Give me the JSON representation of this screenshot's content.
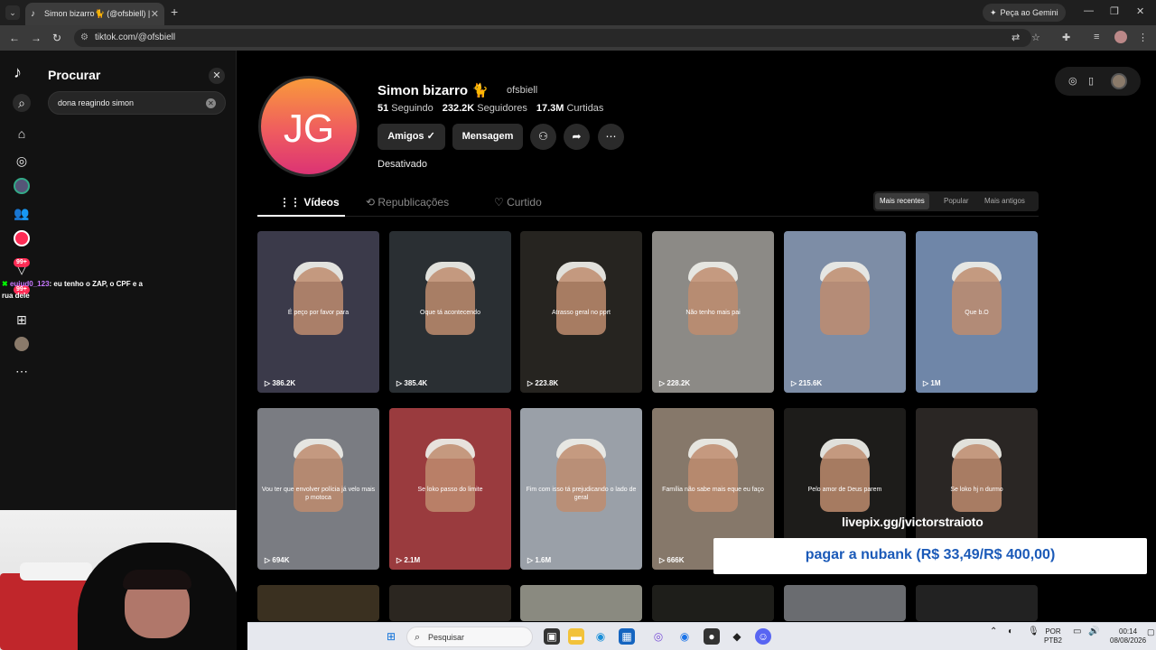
{
  "browser": {
    "tab_title": "Simon bizarro🐈 (@ofsbiell) | T",
    "gemini_label": "Peça ao Gemini",
    "url": "tiktok.com/@ofsbiell"
  },
  "sidebar": {
    "search_title": "Procurar",
    "search_value": "dona reagindo simon",
    "badge_1": "99+",
    "badge_2": "99+",
    "chat_user": "euiud0_123",
    "chat_text": ": eu tenho o ZAP, o CPF e a rua dele"
  },
  "profile": {
    "avatar_initials": "JG",
    "name": "Simon bizarro 🐈",
    "handle": "ofsbiell",
    "following_count": "51",
    "following_label": "Seguindo",
    "followers_count": "232.2K",
    "followers_label": "Seguidores",
    "likes_count": "17.3M",
    "likes_label": "Curtidas",
    "friends_button": "Amigos ✓",
    "message_button": "Mensagem",
    "bio": "Desativado"
  },
  "tabs": {
    "videos": "Vídeos",
    "reposts": "Republicações",
    "liked": "Curtido",
    "sort_recent": "Mais recentes",
    "sort_popular": "Popular",
    "sort_oldest": "Mais antigos"
  },
  "videos": [
    {
      "caption": "É peço por favor para",
      "views": "386.2K",
      "color": "#3b3a4a"
    },
    {
      "caption": "Oque tá acontecendo",
      "views": "385.4K",
      "color": "#2a2f33"
    },
    {
      "caption": "Atrasso geral no pprt",
      "views": "223.8K",
      "color": "#262420"
    },
    {
      "caption": "Não tenho mais pai",
      "views": "228.2K",
      "color": "#8c8a86"
    },
    {
      "caption": "",
      "views": "215.6K",
      "color": "#7d8da6"
    },
    {
      "caption": "Que b.O",
      "views": "1M",
      "color": "#6f86a8"
    },
    {
      "caption": "Vou ter que envolver polícia já velo mais p motoca",
      "views": "694K",
      "color": "#7a7c82"
    },
    {
      "caption": "Se loko passo do limite",
      "views": "2.1M",
      "color": "#9a3b3e"
    },
    {
      "caption": "Fim com isso tá prejudicando o lado de geral",
      "views": "1.6M",
      "color": "#9aa0a8"
    },
    {
      "caption": "Família não sabe mais eque eu faço",
      "views": "666K",
      "color": "#86786a"
    },
    {
      "caption": "Pelo amor de Deus parem",
      "views": "",
      "color": "#1d1c1a"
    },
    {
      "caption": "Se loko hj n durmo",
      "views": "",
      "color": "#2a2624"
    }
  ],
  "stream_overlay": {
    "livepix": "livepix.gg/jvictorstraioto",
    "goal": "pagar a nubank (R$ 33,49/R$ 400,00)"
  },
  "taskbar": {
    "search_placeholder": "Pesquisar",
    "lang_1": "POR",
    "lang_2": "PTB2",
    "time": "00:14",
    "date": "08/08/2026"
  },
  "colors": {
    "tiktok_red": "#fe2c55",
    "avatar_gradient_top": "#f99a3b",
    "avatar_gradient_bottom": "#dc3374",
    "overlay_text_blue": "#1b5ab8"
  }
}
